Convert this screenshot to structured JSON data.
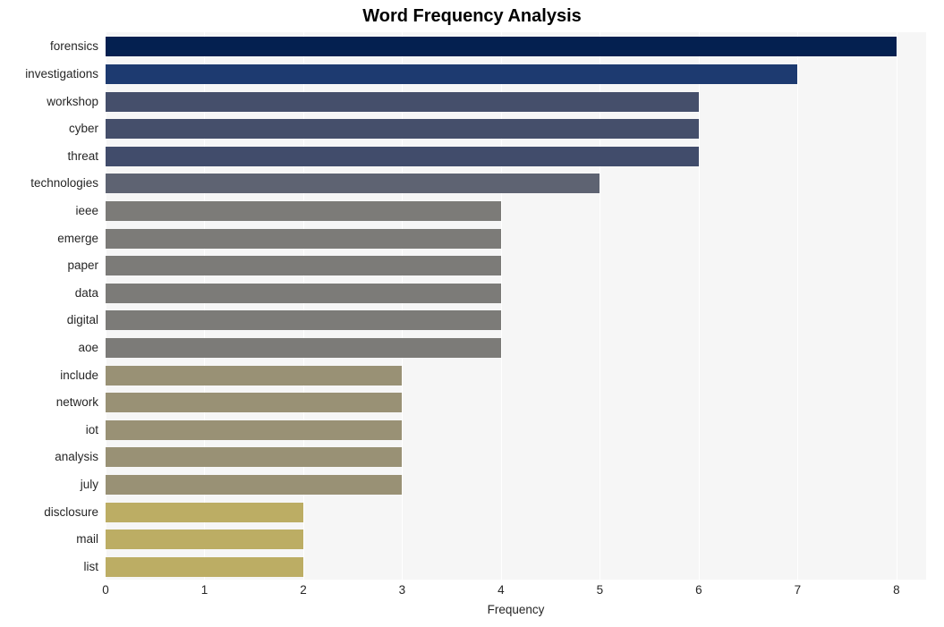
{
  "chart_data": {
    "type": "bar",
    "orientation": "horizontal",
    "title": "Word Frequency Analysis",
    "xlabel": "Frequency",
    "ylabel": "",
    "xlim": [
      0,
      8.3
    ],
    "xticks": [
      "0",
      "1",
      "2",
      "3",
      "4",
      "5",
      "6",
      "7",
      "8"
    ],
    "xtick_values": [
      0,
      1,
      2,
      3,
      4,
      5,
      6,
      7,
      8
    ],
    "grid": "vertical-only",
    "legend": "none",
    "categories": [
      "forensics",
      "investigations",
      "workshop",
      "cyber",
      "threat",
      "technologies",
      "ieee",
      "emerge",
      "paper",
      "data",
      "digital",
      "aoe",
      "include",
      "network",
      "iot",
      "analysis",
      "july",
      "disclosure",
      "mail",
      "list"
    ],
    "values": [
      8,
      7,
      6,
      6,
      6,
      5,
      4,
      4,
      4,
      4,
      4,
      4,
      3,
      3,
      3,
      3,
      3,
      2,
      2,
      2
    ],
    "bar_colors": [
      "#042050",
      "#1d3a70",
      "#454f6b",
      "#454f6b",
      "#414c6b",
      "#5e6372",
      "#7c7b78",
      "#7c7b78",
      "#7c7b78",
      "#7c7b78",
      "#7c7b78",
      "#7c7b78",
      "#999175",
      "#999175",
      "#999175",
      "#999175",
      "#999175",
      "#bcad64",
      "#bcad64",
      "#bcad64"
    ],
    "colors": {
      "figure_background": "#ffffff",
      "plot_background": "#f6f6f6",
      "gridline": "#ffffff",
      "text": "#262626",
      "title": "#000000"
    }
  }
}
